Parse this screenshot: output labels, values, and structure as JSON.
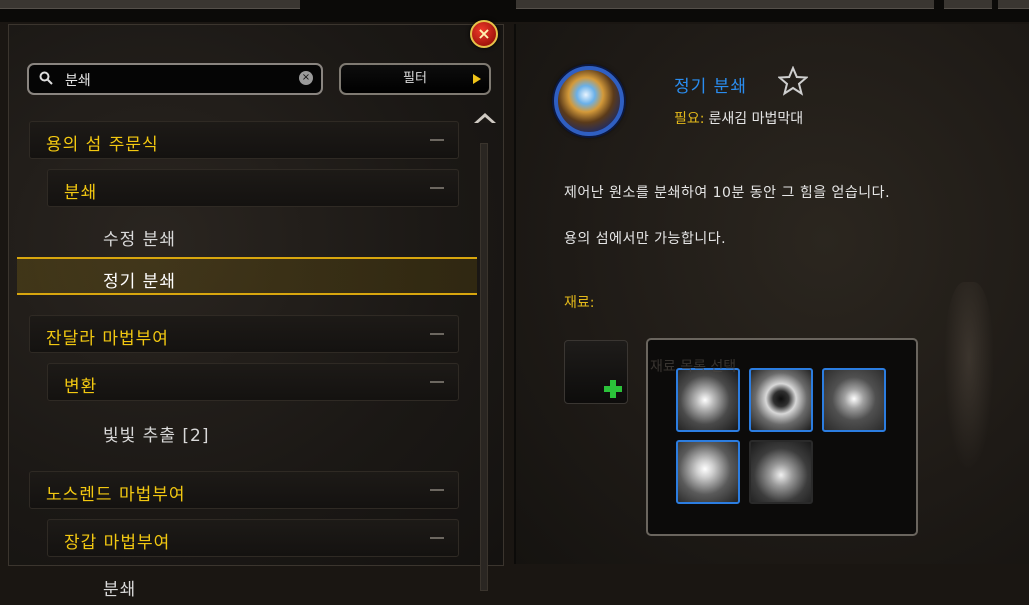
{
  "search": {
    "value": "분쇄",
    "clear_glyph": "×"
  },
  "filter_button": {
    "label": "필터"
  },
  "close_button": {
    "glyph": "×"
  },
  "recipe_list": [
    {
      "label": "용의 섬 주문식",
      "level": 0,
      "type": "header"
    },
    {
      "label": "분쇄",
      "level": 1,
      "type": "header"
    },
    {
      "label": "수정 분쇄",
      "level": 2,
      "type": "item"
    },
    {
      "label": "정기 분쇄",
      "level": 2,
      "type": "item",
      "selected": true
    },
    {
      "label": "잔달라 마법부여",
      "level": 0,
      "type": "header"
    },
    {
      "label": "변환",
      "level": 1,
      "type": "header"
    },
    {
      "label": "빛빛 추출 [2]",
      "level": 2,
      "type": "item"
    },
    {
      "label": "노스렌드 마법부여",
      "level": 0,
      "type": "header"
    },
    {
      "label": "장갑 마법부여",
      "level": 1,
      "type": "header"
    },
    {
      "label": "분쇄",
      "level": 2,
      "type": "item"
    }
  ],
  "detail": {
    "title": "정기 분쇄",
    "requires_label": "필요:",
    "requires_value": "룬새김 마법막대",
    "description_lines": [
      "제어난 원소를 분쇄하여 10분 동안 그 힘을 얻습니다.",
      "용의 섬에서만 가능합니다."
    ],
    "materials_label": "재료:",
    "ghost_text": "재료 목록 선택"
  },
  "colors": {
    "gold": "#f2c811",
    "blue_title": "#2a8df0",
    "slot_border": "#2c7de0",
    "add_green": "#2bc23a"
  },
  "icons": [
    "search-icon",
    "clear-icon",
    "close-icon",
    "star-icon",
    "plus-icon",
    "scroll-up-icon"
  ]
}
